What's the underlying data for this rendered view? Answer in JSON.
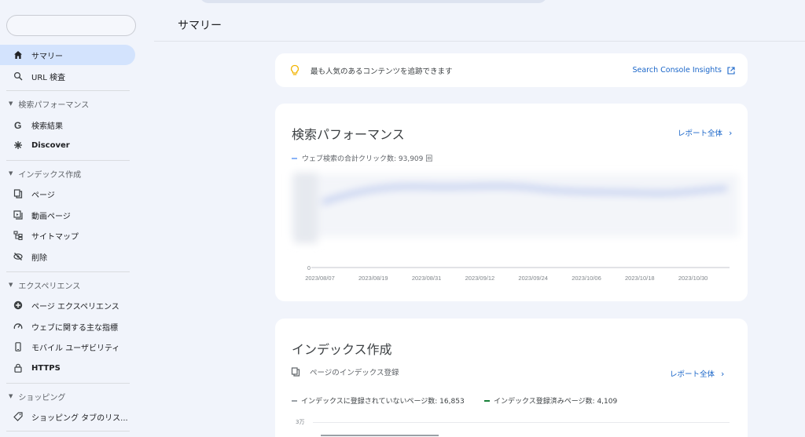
{
  "sidebar": {
    "summary": "サマリー",
    "url_inspection": "URL 検査",
    "section_performance": "検索パフォーマンス",
    "search_results": "検索結果",
    "discover": "Discover",
    "section_index": "インデックス作成",
    "pages": "ページ",
    "video_pages": "動画ページ",
    "sitemaps": "サイトマップ",
    "removals": "削除",
    "section_experience": "エクスペリエンス",
    "page_experience": "ページ エクスペリエンス",
    "core_web_vitals": "ウェブに関する主な指標",
    "mobile_usability": "モバイル ユーザビリティ",
    "https": "HTTPS",
    "section_shopping": "ショッピング",
    "shopping_tab": "ショッピング タブのリス..."
  },
  "header": {
    "title": "サマリー"
  },
  "insights": {
    "message": "最も人気のあるコンテンツを追跡できます",
    "link": "Search Console Insights"
  },
  "performance": {
    "title": "検索パフォーマンス",
    "report_link": "レポート全体",
    "legend": "ウェブ検索の合計クリック数: 93,909 回",
    "accent": "#8ab4f8"
  },
  "chart_data": {
    "type": "line",
    "x": [
      "2023/08/07",
      "2023/08/19",
      "2023/08/31",
      "2023/09/12",
      "2023/09/24",
      "2023/10/06",
      "2023/10/18",
      "2023/10/30"
    ],
    "y_min_label": "0",
    "series": [
      {
        "name": "ウェブ検索の合計クリック数",
        "values": []
      }
    ]
  },
  "indexing": {
    "title": "インデックス作成",
    "subtitle": "ページのインデックス登録",
    "report_link": "レポート全体",
    "legend_not_indexed": "インデックスに登録されていないページ数: 16,853",
    "legend_indexed": "インデックス登録済みページ数: 4,109",
    "ytick": "3万",
    "color_not_indexed": "#9aa0a6",
    "color_indexed": "#188038"
  }
}
